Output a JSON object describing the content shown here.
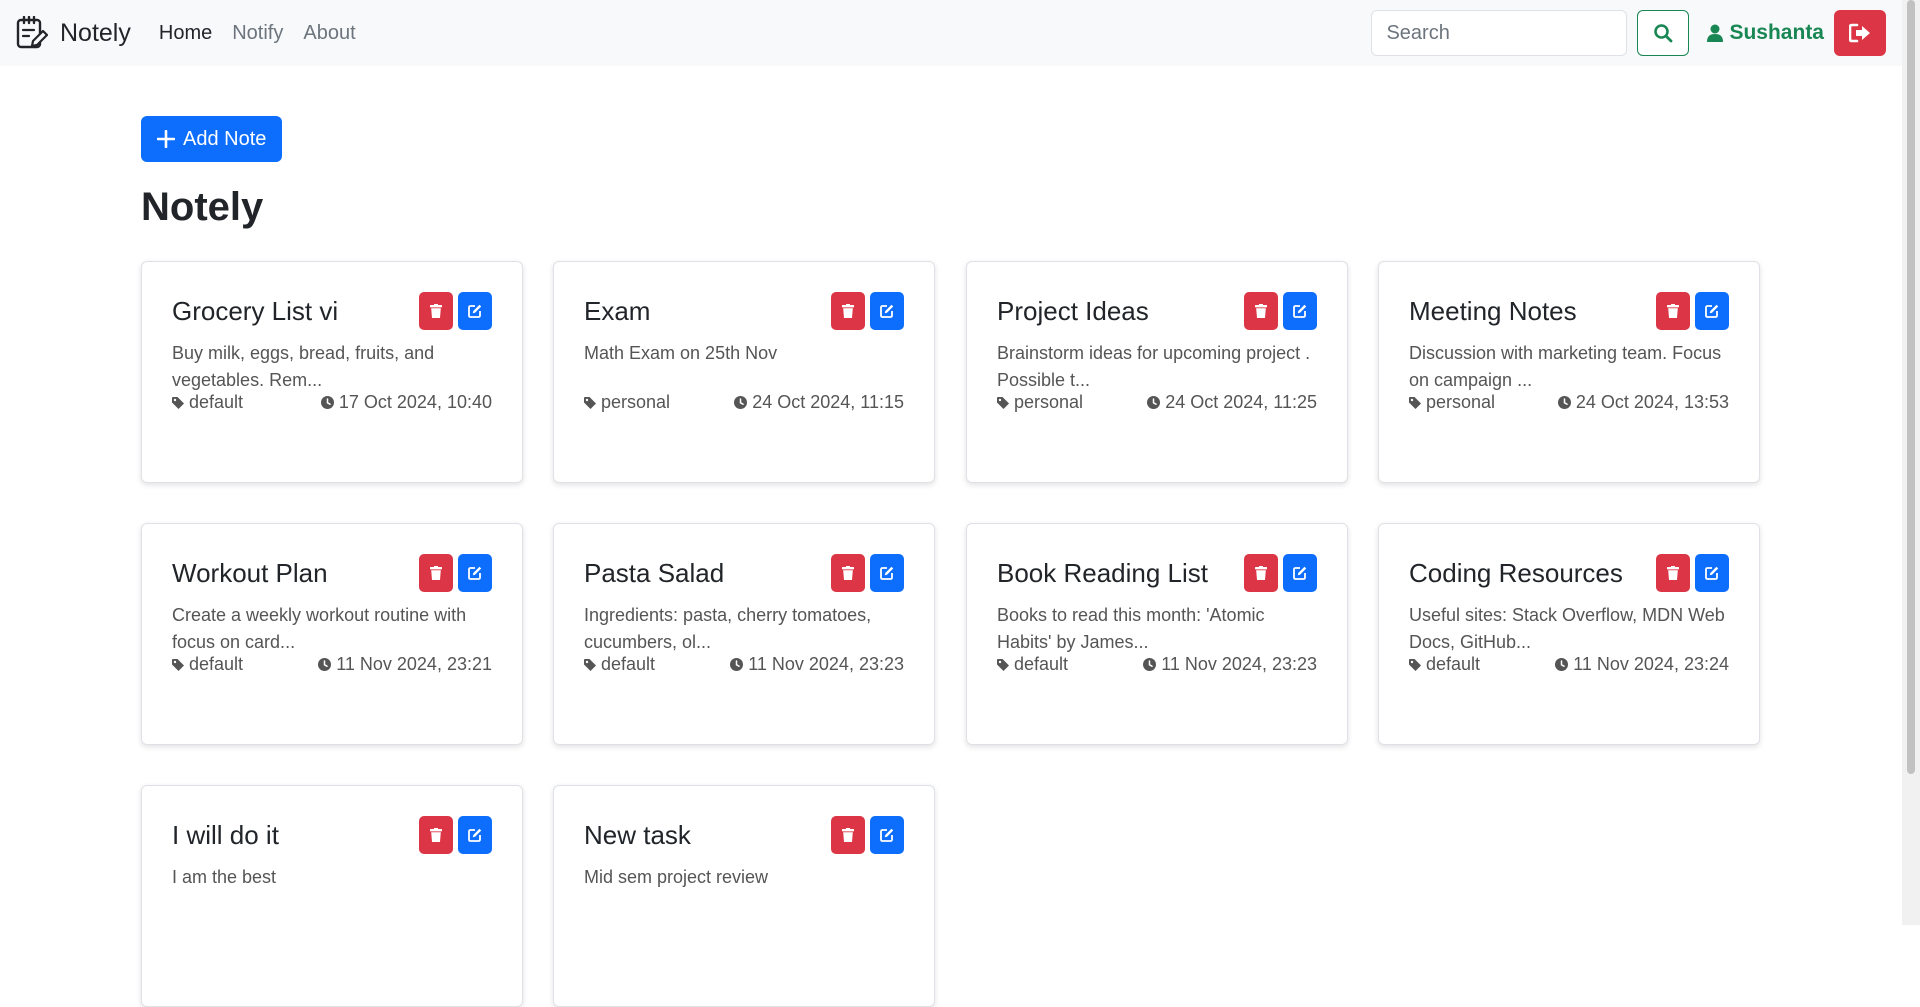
{
  "nav": {
    "brand": "Notely",
    "links": [
      "Home",
      "Notify",
      "About"
    ],
    "search_placeholder": "Search",
    "user_name": "Sushanta"
  },
  "main": {
    "add_label": "Add Note",
    "title": "Notely"
  },
  "notes": [
    {
      "title": "Grocery List vi",
      "desc": "Buy milk, eggs, bread, fruits, and vegetables. Rem...",
      "tag": "default",
      "date": "17 Oct 2024, 10:40"
    },
    {
      "title": "Exam",
      "desc": "Math Exam on 25th Nov",
      "tag": "personal",
      "date": "24 Oct 2024, 11:15"
    },
    {
      "title": "Project Ideas",
      "desc": "Brainstorm ideas for upcoming project . Possible t...",
      "tag": "personal",
      "date": "24 Oct 2024, 11:25"
    },
    {
      "title": "Meeting Notes",
      "desc": "Discussion with marketing team. Focus on campaign ...",
      "tag": "personal",
      "date": "24 Oct 2024, 13:53"
    },
    {
      "title": "Workout Plan",
      "desc": "Create a weekly workout routine with focus on card...",
      "tag": "default",
      "date": "11 Nov 2024, 23:21"
    },
    {
      "title": "Pasta Salad",
      "desc": "Ingredients: pasta, cherry tomatoes, cucumbers, ol...",
      "tag": "default",
      "date": "11 Nov 2024, 23:23"
    },
    {
      "title": "Book Reading List",
      "desc": "Books to read this month: 'Atomic Habits' by James...",
      "tag": "default",
      "date": "11 Nov 2024, 23:23"
    },
    {
      "title": "Coding Resources",
      "desc": "Useful sites: Stack Overflow, MDN Web Docs, GitHub...",
      "tag": "default",
      "date": "11 Nov 2024, 23:24"
    },
    {
      "title": "I will do it",
      "desc": "I am the best",
      "tag": "",
      "date": ""
    },
    {
      "title": "New task",
      "desc": "Mid sem project review",
      "tag": "",
      "date": ""
    }
  ],
  "colors": {
    "primary": "#0d6efd",
    "danger": "#dc3545",
    "success": "#198754"
  }
}
